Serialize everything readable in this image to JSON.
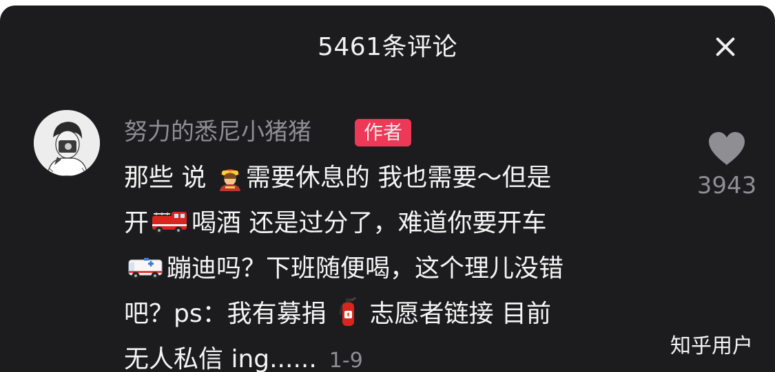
{
  "header": {
    "title": "5461条评论",
    "close_icon": "close-icon"
  },
  "comment": {
    "username": "努力的悉尼小猪猪",
    "badge": "作者",
    "lines": [
      [
        "那些 说 ",
        "需要休息的 我也需要～但是"
      ],
      [
        "开",
        "喝酒 还是过分了，难道你要开车"
      ],
      [
        "",
        "蹦迪吗？下班随便喝，这个理儿没错"
      ],
      [
        "吧？ps：我有募捐 ",
        " 志愿者链接 目前"
      ],
      [
        "无人私信 ing......"
      ]
    ],
    "emoji_icons": [
      "firefighter-icon",
      "fire-truck-icon",
      "ambulance-icon",
      "fire-extinguisher-icon"
    ],
    "time": "1-9",
    "like_count": "3943"
  },
  "watermark": "知乎用户",
  "colors": {
    "background": "#1c1c1e",
    "badge": "#ff3b5c",
    "secondary_text": "#8e8e93"
  }
}
